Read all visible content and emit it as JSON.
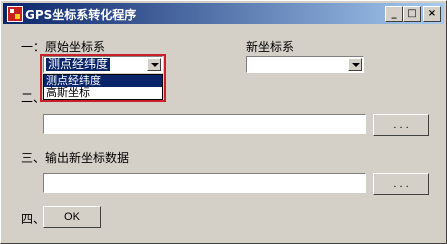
{
  "window": {
    "title": "GPS坐标系转化程序",
    "controls": {
      "minimize": "_",
      "maximize": "□",
      "close": "×"
    }
  },
  "step1": {
    "label": "一：原始坐标系",
    "source_combo": {
      "selected": "测点经纬度",
      "options": [
        "测点经纬度",
        "高斯坐标"
      ],
      "highlighted_index": 0
    },
    "target_label": "新坐标系",
    "target_combo": {
      "selected": ""
    }
  },
  "step2": {
    "label": "二、",
    "path_value": "",
    "browse_label": ". . ."
  },
  "step3": {
    "label": "三、输出新坐标数据",
    "path_value": "",
    "browse_label": ". . ."
  },
  "step4": {
    "label": "四、",
    "ok_label": "OK"
  },
  "colors": {
    "title_bar_start": "#0a246a",
    "title_bar_end": "#a6caf0",
    "highlight_border": "#c8202a",
    "selection_bg": "#0a246a"
  }
}
